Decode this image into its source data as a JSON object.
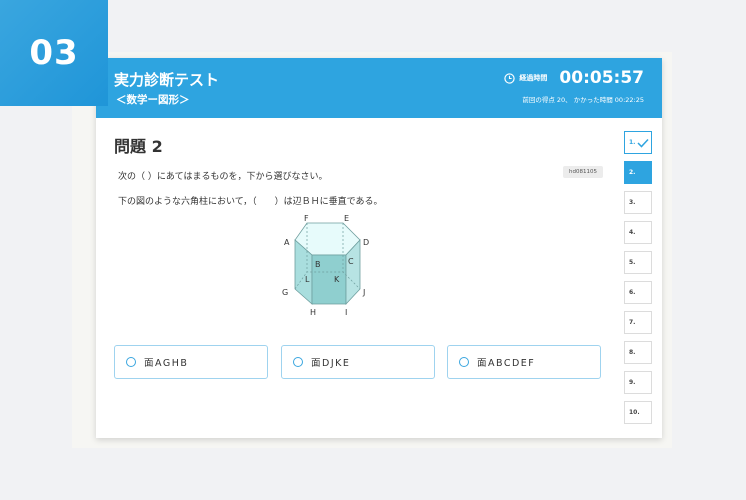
{
  "step_badge": "03",
  "header": {
    "title": "実力診断テスト",
    "subtitle": "＜数学ー図形＞",
    "timer_label": "経過時間",
    "timer_value": "00:05:57",
    "info": "前回の得点 20、 かかった時間 00:22:25"
  },
  "question": {
    "title": "問題 2",
    "instruction": "次の（ ）にあてはまるものを，下から選びなさい。",
    "id": "hd081105",
    "text": "下の図のような六角柱において，（　　）は辺ＢＨに垂直である。",
    "figure_labels": [
      "A",
      "B",
      "C",
      "D",
      "E",
      "F",
      "G",
      "H",
      "I",
      "J",
      "K",
      "L"
    ]
  },
  "choices": [
    "面AGHB",
    "面DJKE",
    "面ABCDEF"
  ],
  "question_nav": [
    {
      "label": "1.",
      "state": "done"
    },
    {
      "label": "2.",
      "state": "active"
    },
    {
      "label": "3.",
      "state": "default"
    },
    {
      "label": "4.",
      "state": "default"
    },
    {
      "label": "5.",
      "state": "default"
    },
    {
      "label": "6.",
      "state": "default"
    },
    {
      "label": "7.",
      "state": "default"
    },
    {
      "label": "8.",
      "state": "default"
    },
    {
      "label": "9.",
      "state": "default"
    },
    {
      "label": "10.",
      "state": "default"
    }
  ],
  "colors": {
    "accent": "#2ea4e0",
    "choice_border": "#9fd3ef",
    "prism_fill": "#a9dede"
  }
}
